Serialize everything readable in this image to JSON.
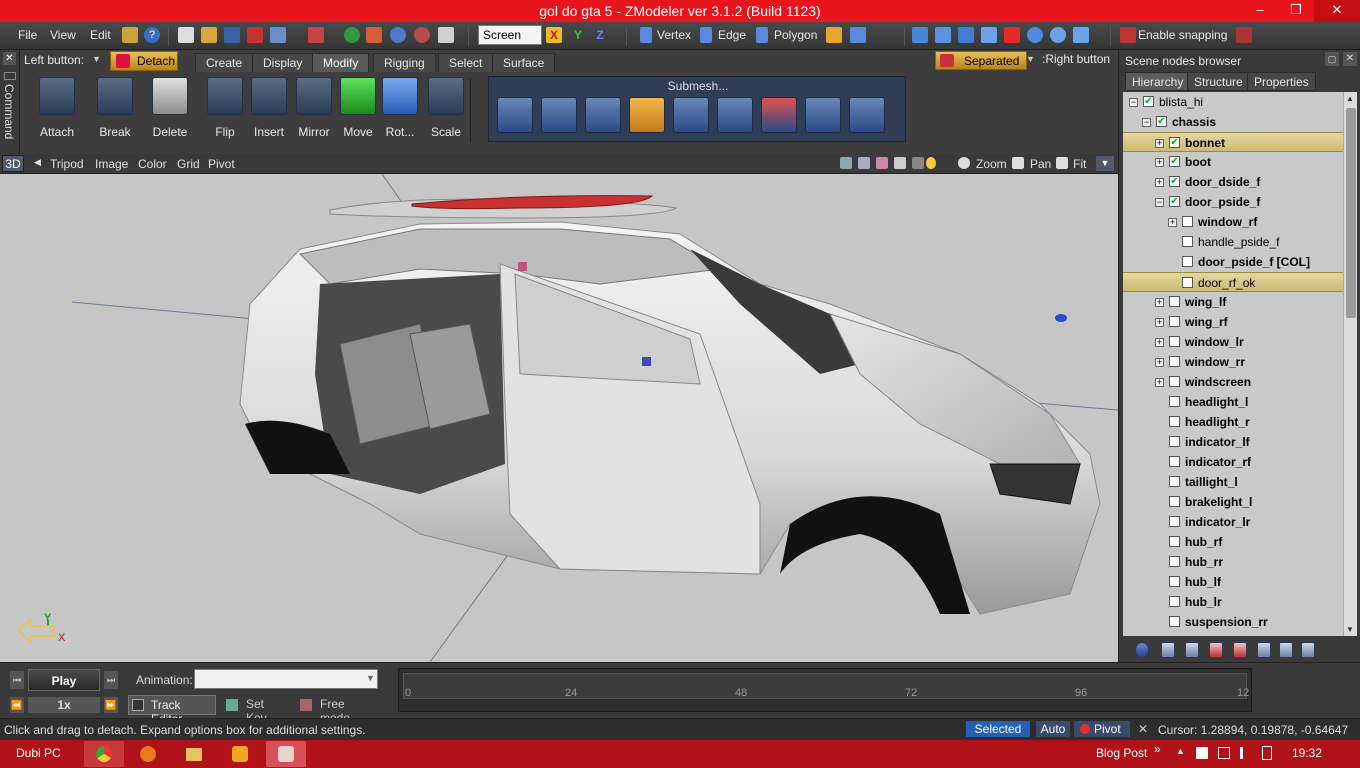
{
  "window": {
    "title": "gol do gta 5 - ZModeler ver 3.1.2 (Build 1123)",
    "minimize": "–",
    "maximize": "❐",
    "close": "✕"
  },
  "menu": {
    "file": "File",
    "view": "View",
    "edit": "Edit",
    "help": "?"
  },
  "toolbar": {
    "coord_select": "Screen",
    "axis_x": "X",
    "axis_y": "Y",
    "axis_z": "Z",
    "vertex": "Vertex",
    "edge": "Edge",
    "polygon": "Polygon",
    "snapping": "Enable snapping"
  },
  "row2": {
    "left_button_label": "Left button:",
    "left_button_action": "Detach",
    "separated": "Separated",
    ":right_button": ":Right button",
    "tabs": [
      "Create",
      "Display",
      "Modify",
      "Rigging",
      "Select",
      "Surface"
    ],
    "active_tab": "Modify"
  },
  "command_strip": "Command",
  "ribbon": {
    "tools": [
      "Attach",
      "Break",
      "Delete",
      "Flip",
      "Insert",
      "Mirror",
      "Move",
      "Rot...",
      "Scale"
    ],
    "submesh_title": "Submesh..."
  },
  "viewport_bar": {
    "mode": "3D",
    "items": [
      "Tripod",
      "Image",
      "Color",
      "Grid",
      "Pivot"
    ],
    "zoom": "Zoom",
    "pan": "Pan",
    "fit": "Fit"
  },
  "axis": {
    "y": "Y",
    "x": "X"
  },
  "scene_browser": {
    "title": "Scene nodes browser",
    "tabs": [
      "Hierarchy",
      "Structure",
      "Properties"
    ],
    "nodes": [
      {
        "label": "blista_hi",
        "indent": 0,
        "expander": "−",
        "checked": true,
        "bold": false,
        "highlight": false
      },
      {
        "label": "chassis",
        "indent": 1,
        "expander": "−",
        "checked": true,
        "bold": true,
        "highlight": false
      },
      {
        "label": "bonnet",
        "indent": 2,
        "expander": "+",
        "checked": true,
        "bold": true,
        "highlight": true
      },
      {
        "label": "boot",
        "indent": 2,
        "expander": "+",
        "checked": true,
        "bold": true,
        "highlight": false
      },
      {
        "label": "door_dside_f",
        "indent": 2,
        "expander": "+",
        "checked": true,
        "bold": true,
        "highlight": false
      },
      {
        "label": "door_pside_f",
        "indent": 2,
        "expander": "−",
        "checked": true,
        "bold": true,
        "highlight": false
      },
      {
        "label": "window_rf",
        "indent": 3,
        "expander": "+",
        "checked": false,
        "bold": true,
        "highlight": false
      },
      {
        "label": "handle_pside_f",
        "indent": 3,
        "expander": "",
        "checked": false,
        "bold": false,
        "highlight": false
      },
      {
        "label": "door_pside_f [COL]",
        "indent": 3,
        "expander": "",
        "checked": false,
        "bold": true,
        "highlight": false
      },
      {
        "label": "door_rf_ok",
        "indent": 3,
        "expander": "",
        "checked": false,
        "bold": false,
        "highlight": true
      },
      {
        "label": "wing_lf",
        "indent": 2,
        "expander": "+",
        "checked": false,
        "bold": true,
        "highlight": false
      },
      {
        "label": "wing_rf",
        "indent": 2,
        "expander": "+",
        "checked": false,
        "bold": true,
        "highlight": false
      },
      {
        "label": "window_lr",
        "indent": 2,
        "expander": "+",
        "checked": false,
        "bold": true,
        "highlight": false
      },
      {
        "label": "window_rr",
        "indent": 2,
        "expander": "+",
        "checked": false,
        "bold": true,
        "highlight": false
      },
      {
        "label": "windscreen",
        "indent": 2,
        "expander": "+",
        "checked": false,
        "bold": true,
        "highlight": false
      },
      {
        "label": "headlight_l",
        "indent": 2,
        "expander": "",
        "checked": false,
        "bold": true,
        "highlight": false
      },
      {
        "label": "headlight_r",
        "indent": 2,
        "expander": "",
        "checked": false,
        "bold": true,
        "highlight": false
      },
      {
        "label": "indicator_lf",
        "indent": 2,
        "expander": "",
        "checked": false,
        "bold": true,
        "highlight": false
      },
      {
        "label": "indicator_rf",
        "indent": 2,
        "expander": "",
        "checked": false,
        "bold": true,
        "highlight": false
      },
      {
        "label": "taillight_l",
        "indent": 2,
        "expander": "",
        "checked": false,
        "bold": true,
        "highlight": false
      },
      {
        "label": "brakelight_l",
        "indent": 2,
        "expander": "",
        "checked": false,
        "bold": true,
        "highlight": false
      },
      {
        "label": "indicator_lr",
        "indent": 2,
        "expander": "",
        "checked": false,
        "bold": true,
        "highlight": false
      },
      {
        "label": "hub_rf",
        "indent": 2,
        "expander": "",
        "checked": false,
        "bold": true,
        "highlight": false
      },
      {
        "label": "hub_rr",
        "indent": 2,
        "expander": "",
        "checked": false,
        "bold": true,
        "highlight": false
      },
      {
        "label": "hub_lf",
        "indent": 2,
        "expander": "",
        "checked": false,
        "bold": true,
        "highlight": false
      },
      {
        "label": "hub_lr",
        "indent": 2,
        "expander": "",
        "checked": false,
        "bold": true,
        "highlight": false
      },
      {
        "label": "suspension_rr",
        "indent": 2,
        "expander": "",
        "checked": false,
        "bold": true,
        "highlight": false
      }
    ]
  },
  "animation": {
    "play": "Play",
    "speed": "1x",
    "label": "Animation:",
    "value": "",
    "track_editor": "Track Editor",
    "set_key": "Set Key",
    "free_mode": "Free mode",
    "ticks": [
      "0",
      "24",
      "48",
      "72",
      "96",
      "12"
    ]
  },
  "status": {
    "message": "Click and drag to detach. Expand options box for additional settings.",
    "selected": "Selected",
    "auto": "Auto",
    "pivot": "Pivot",
    "cursor": "Cursor: 1.28894, 0.19878, -0.64647"
  },
  "taskbar": {
    "user": "Dubi PC",
    "blog": "Blog Post",
    "chevron": "»",
    "time": "19:32"
  },
  "colors": {
    "titlebar": "#e8141b",
    "taskbar": "#b01218",
    "highlight": "#d8c985",
    "accent": "#2460b8"
  }
}
